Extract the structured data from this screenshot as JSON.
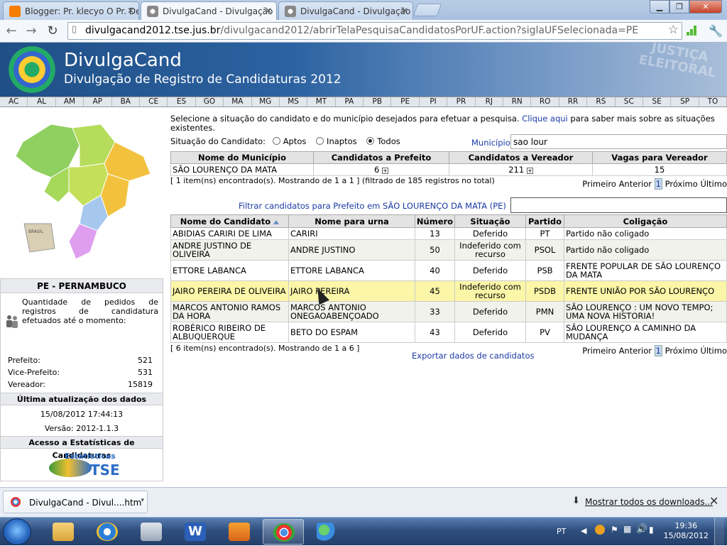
{
  "browser": {
    "tabs": [
      {
        "title": "Blogger: Pr. klecyo O Pr. De"
      },
      {
        "title": "DivulgaCand - Divulgação"
      },
      {
        "title": "DivulgaCand - Divulgação"
      }
    ],
    "url_host": "divulgacand2012.tse.jus.br",
    "url_path": "/divulgacand2012/abrirTelaPesquisaCandidatosPorUF.action?siglaUFSelecionada=PE"
  },
  "banner": {
    "title": "DivulgaCand",
    "subtitle": "Divulgação de Registro de Candidaturas 2012",
    "stamp": "JUSTIÇA ELEITORAL"
  },
  "ufs": [
    "AC",
    "AL",
    "AM",
    "AP",
    "BA",
    "CE",
    "ES",
    "GO",
    "MA",
    "MG",
    "MS",
    "MT",
    "PA",
    "PB",
    "PE",
    "PI",
    "PR",
    "RJ",
    "RN",
    "RO",
    "RR",
    "RS",
    "SC",
    "SE",
    "SP",
    "TO"
  ],
  "sidebar": {
    "map_label": "BRASIL",
    "state_title": "PE - PERNAMBUCO",
    "desc": "Quantidade de pedidos de registros de candidatura efetuados até o momento:",
    "counts": [
      {
        "label": "Prefeito:",
        "value": "521"
      },
      {
        "label": "Vice-Prefeito:",
        "value": "531"
      },
      {
        "label": "Vereador:",
        "value": "15819"
      }
    ],
    "update_title": "Última atualização dos dados",
    "update_date": "15/08/2012 17:44:13",
    "version": "Versão: 2012-1.1.3",
    "stats_title": "Acesso a Estatísticas de Candidaturas",
    "stats_logo_top": "Estatísticas",
    "stats_logo_bottom": "TSE"
  },
  "search": {
    "intro": "Selecione a situação do candidato e do município desejados para efetuar a pesquisa.",
    "intro_link": "Clique aqui",
    "intro_rest": "para saber mais sobre as situações existentes.",
    "situacao_label": "Situação do Candidato:",
    "options": [
      "Aptos",
      "Inaptos",
      "Todos"
    ],
    "selected": "Todos",
    "municipio_label": "Município",
    "municipio_value": "sao lour"
  },
  "municipio_table": {
    "headers": [
      "Nome do Município",
      "Candidatos a Prefeito",
      "Candidatos a Vereador",
      "Vagas para Vereador"
    ],
    "row": {
      "nome": "SÃO LOURENÇO DA MATA",
      "prefeito": "6",
      "vereador": "211",
      "vagas": "15"
    },
    "info": "[ 1 item(ns) encontrado(s). Mostrando de 1 a 1 ] (filtrado de 185 registros no total)"
  },
  "pager": {
    "first": "Primeiro",
    "prev": "Anterior",
    "current": "1",
    "next": "Próximo",
    "last": "Último"
  },
  "filter_label": "Filtrar candidatos para Prefeito em SÃO LOURENÇO DA MATA (PE)",
  "candidates": {
    "headers": [
      "Nome do Candidato",
      "Nome para urna",
      "Número",
      "Situação",
      "Partido",
      "Coligação"
    ],
    "rows": [
      {
        "nome": "ABIDIAS CARIRI DE LIMA",
        "urna": "CARIRI",
        "numero": "13",
        "situacao": "Deferido",
        "partido": "PT",
        "coligacao": "Partido não coligado"
      },
      {
        "nome": "ANDRE JUSTINO DE OLIVEIRA",
        "urna": "ANDRE JUSTINO",
        "numero": "50",
        "situacao": "Indeferido com recurso",
        "partido": "PSOL",
        "coligacao": "Partido não coligado"
      },
      {
        "nome": "ETTORE LABANCA",
        "urna": "ETTORE LABANCA",
        "numero": "40",
        "situacao": "Deferido",
        "partido": "PSB",
        "coligacao": "FRENTE POPULAR DE SÃO LOURENÇO DA MATA"
      },
      {
        "nome": "JAIRO PEREIRA DE OLIVEIRA",
        "urna": "JAIRO PEREIRA",
        "numero": "45",
        "situacao": "Indeferido com recurso",
        "partido": "PSDB",
        "coligacao": "FRENTE UNIÃO POR SÃO LOURENÇO"
      },
      {
        "nome": "MARCOS ANTONIO RAMOS DA HORA",
        "urna": "MARCOS ANTONIO ONEGAOABENÇOADO",
        "numero": "33",
        "situacao": "Deferido",
        "partido": "PMN",
        "coligacao": "SÃO LOURENÇO : UM NOVO TEMPO; UMA NOVA HISTORIA!"
      },
      {
        "nome": "ROBÉRICO RIBEIRO DE ALBUQUERQUE",
        "urna": "BETO DO ESPAM",
        "numero": "43",
        "situacao": "Deferido",
        "partido": "PV",
        "coligacao": "SÃO LOURENÇO A CAMINHO DA MUDANÇA"
      }
    ],
    "info": "[ 6 item(ns) encontrado(s). Mostrando de 1 a 6 ]",
    "export": "Exportar dados de candidatos"
  },
  "downloads": {
    "item": "DivulgaCand - Divul....htm",
    "show_all": "Mostrar todos os downloads..."
  },
  "taskbar": {
    "lang": "PT",
    "time": "19:36",
    "date": "15/08/2012"
  },
  "colors": {
    "banner": "#2c62a1",
    "link": "#1a3aa5",
    "highlight_row": "#fbf6a8"
  }
}
